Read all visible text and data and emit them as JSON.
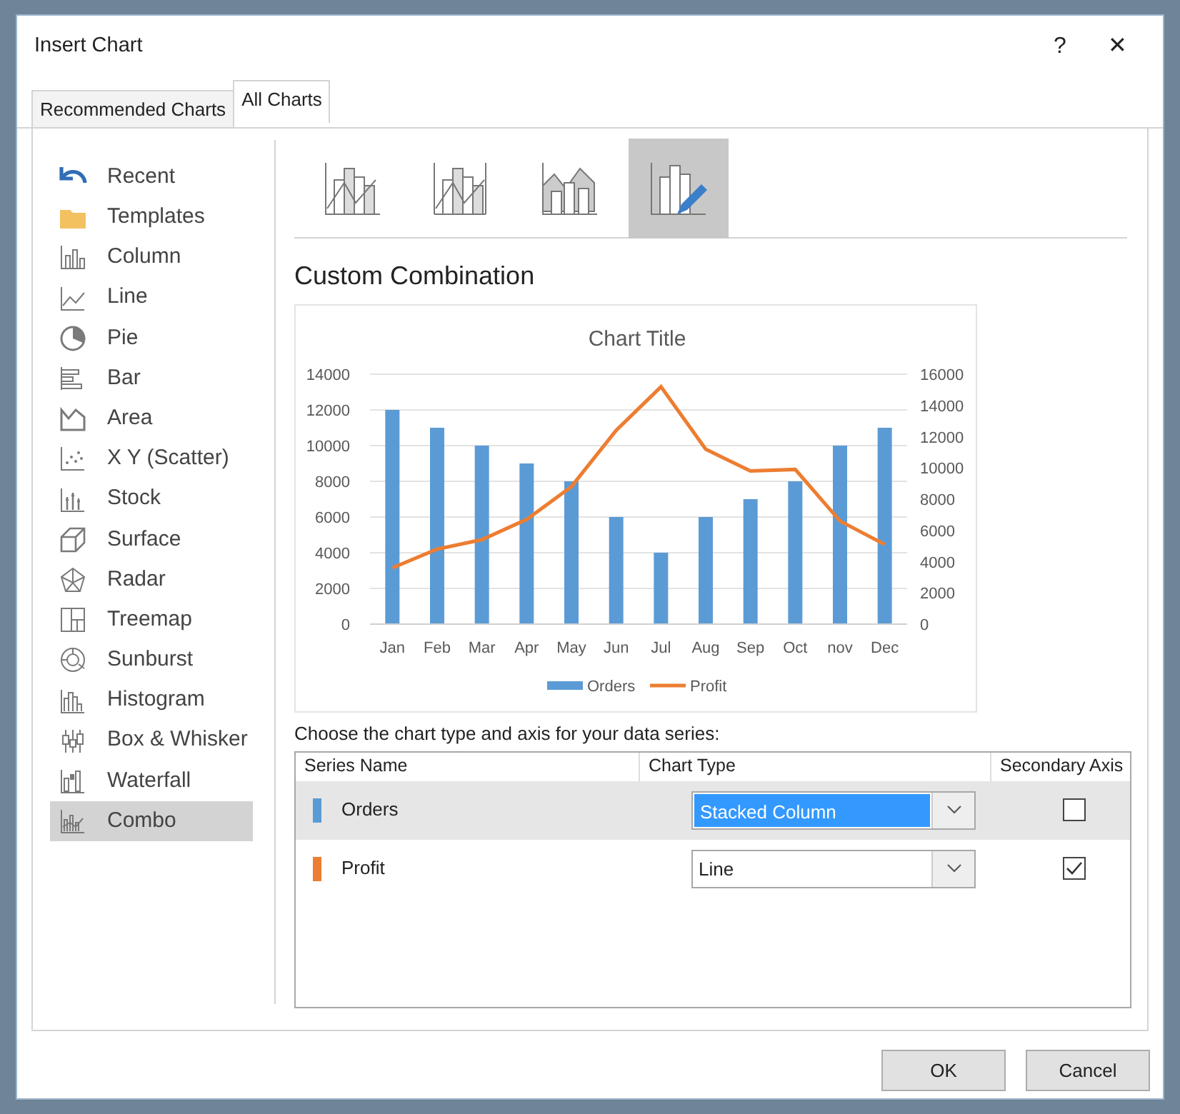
{
  "window": {
    "title": "Insert Chart",
    "help": "?",
    "close": "✕"
  },
  "tabs": [
    {
      "label": "Recommended Charts",
      "selected": false
    },
    {
      "label": "All Charts",
      "selected": true
    }
  ],
  "sidebar": {
    "items": [
      {
        "label": "Recent",
        "selected": false
      },
      {
        "label": "Templates",
        "selected": false
      },
      {
        "label": "Column",
        "selected": false
      },
      {
        "label": "Line",
        "selected": false
      },
      {
        "label": "Pie",
        "selected": false
      },
      {
        "label": "Bar",
        "selected": false
      },
      {
        "label": "Area",
        "selected": false
      },
      {
        "label": "X Y (Scatter)",
        "selected": false
      },
      {
        "label": "Stock",
        "selected": false
      },
      {
        "label": "Surface",
        "selected": false
      },
      {
        "label": "Radar",
        "selected": false
      },
      {
        "label": "Treemap",
        "selected": false
      },
      {
        "label": "Sunburst",
        "selected": false
      },
      {
        "label": "Histogram",
        "selected": false
      },
      {
        "label": "Box & Whisker",
        "selected": false
      },
      {
        "label": "Waterfall",
        "selected": false
      },
      {
        "label": "Combo",
        "selected": true
      }
    ]
  },
  "subtypes": [
    {
      "selected": false
    },
    {
      "selected": false
    },
    {
      "selected": false
    },
    {
      "selected": true
    }
  ],
  "heading": "Custom Combination",
  "preview": {
    "chart_data": {
      "type": "bar",
      "title": "Chart Title",
      "categories": [
        "Jan",
        "Feb",
        "Mar",
        "Apr",
        "May",
        "Jun",
        "Jul",
        "Aug",
        "Sep",
        "Oct",
        "nov",
        "Dec"
      ],
      "series": [
        {
          "name": "Orders",
          "color": "#5b9bd5",
          "values": [
            12000,
            11000,
            10000,
            9000,
            8000,
            6000,
            4000,
            6000,
            7000,
            8000,
            10000,
            11000
          ]
        },
        {
          "name": "Profit",
          "color": "#ed7d31",
          "type": "line",
          "axis": "y2",
          "values": [
            3600,
            4800,
            5400,
            6700,
            8800,
            12400,
            15200,
            11200,
            9800,
            9900,
            6600,
            5100
          ]
        }
      ],
      "ylim": [
        0,
        14000
      ],
      "yticks": [
        0,
        2000,
        4000,
        6000,
        8000,
        10000,
        12000,
        14000
      ],
      "grid": true,
      "legend": "bottom",
      "y2lim": [
        0,
        16000
      ],
      "y2ticks": [
        0,
        2000,
        4000,
        6000,
        8000,
        10000,
        12000,
        14000,
        16000
      ]
    }
  },
  "series_prompt": "Choose the chart type and axis for your data series:",
  "series_table": {
    "columns": [
      "Series Name",
      "Chart Type",
      "Secondary Axis"
    ],
    "rows": [
      {
        "name": "Orders",
        "color": "#5b9bd5",
        "chart_type": "Stacked Column",
        "secondary_axis": false,
        "selected": true
      },
      {
        "name": "Profit",
        "color": "#ed7d31",
        "chart_type": "Line",
        "secondary_axis": true,
        "selected": false
      }
    ]
  },
  "buttons": [
    "OK",
    "Cancel"
  ]
}
